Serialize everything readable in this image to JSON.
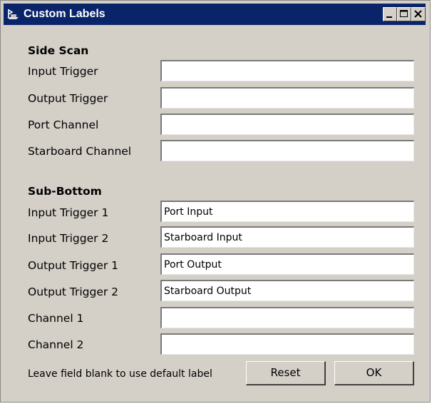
{
  "window": {
    "title": "Custom Labels",
    "icon": "ship-icon",
    "controls": [
      "minimize-icon",
      "maximize-icon",
      "close-icon"
    ]
  },
  "side_scan": {
    "heading": "Side Scan",
    "fields": [
      {
        "label": "Input Trigger",
        "value": ""
      },
      {
        "label": "Output Trigger",
        "value": ""
      },
      {
        "label": "Port Channel",
        "value": ""
      },
      {
        "label": "Starboard Channel",
        "value": ""
      }
    ]
  },
  "sub_bottom": {
    "heading": "Sub-Bottom",
    "fields": [
      {
        "label": "Input Trigger 1",
        "value": "Port Input"
      },
      {
        "label": "Input Trigger 2",
        "value": "Starboard Input"
      },
      {
        "label": "Output Trigger 1",
        "value": "Port Output"
      },
      {
        "label": "Output Trigger 2",
        "value": "Starboard Output"
      },
      {
        "label": "Channel 1",
        "value": ""
      },
      {
        "label": "Channel 2",
        "value": ""
      }
    ]
  },
  "footer": {
    "hint": "Leave field blank to use default label",
    "reset_label": "Reset",
    "ok_label": "OK"
  }
}
